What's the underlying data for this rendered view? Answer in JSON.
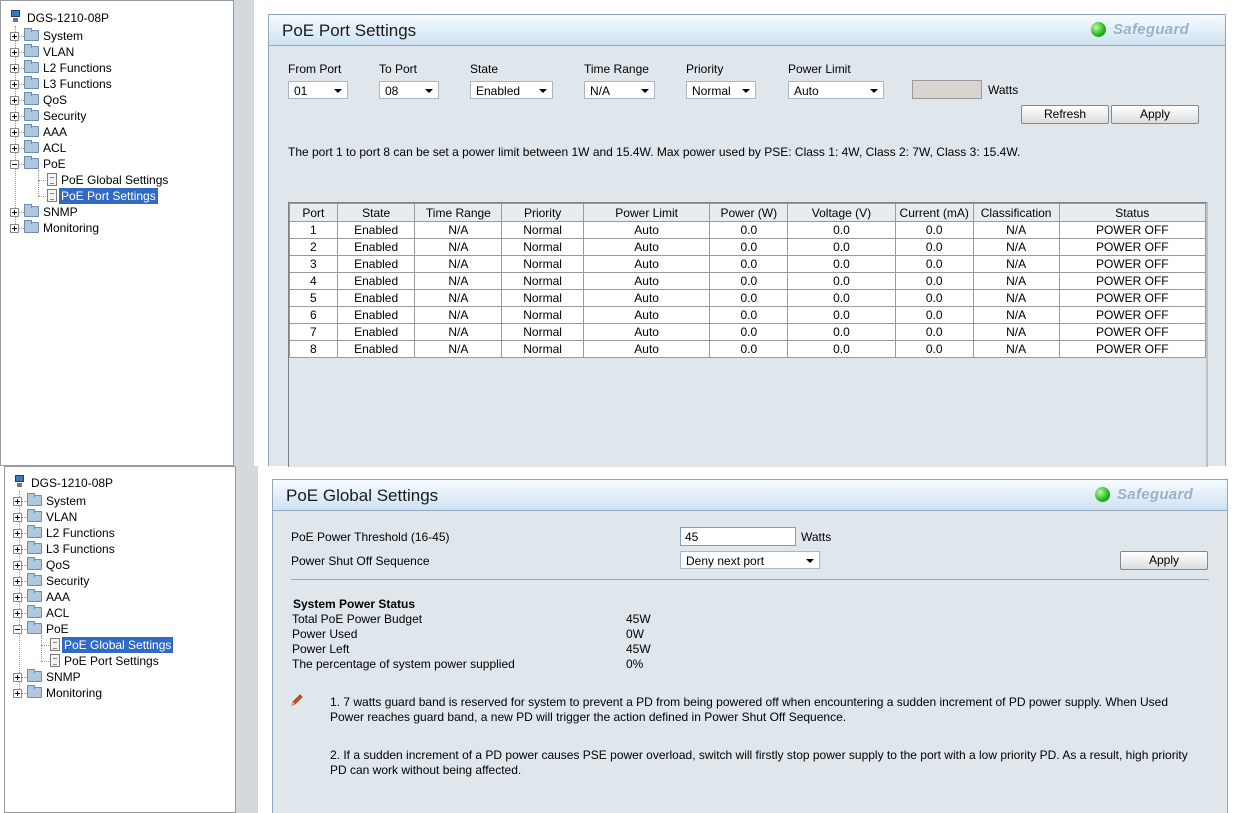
{
  "tree": {
    "root": "DGS-1210-08P",
    "items": [
      "System",
      "VLAN",
      "L2 Functions",
      "L3 Functions",
      "QoS",
      "Security",
      "AAA",
      "ACL",
      "PoE",
      "SNMP",
      "Monitoring"
    ],
    "poe_children": [
      "PoE Global Settings",
      "PoE Port Settings"
    ]
  },
  "safeguard_label": "Safeguard",
  "port_settings": {
    "title": "PoE Port Settings",
    "form": {
      "from_port_label": "From Port",
      "from_port_value": "01",
      "to_port_label": "To Port",
      "to_port_value": "08",
      "state_label": "State",
      "state_value": "Enabled",
      "time_range_label": "Time Range",
      "time_range_value": "N/A",
      "priority_label": "Priority",
      "priority_value": "Normal",
      "power_limit_label": "Power Limit",
      "power_limit_value": "Auto",
      "watts_unit": "Watts",
      "refresh_label": "Refresh",
      "apply_label": "Apply"
    },
    "note": "The port 1 to port 8 can be set a power limit between 1W and 15.4W. Max power used by PSE: Class 1: 4W, Class 2: 7W, Class 3: 15.4W.",
    "columns": [
      "Port",
      "State",
      "Time Range",
      "Priority",
      "Power Limit",
      "Power (W)",
      "Voltage (V)",
      "Current (mA)",
      "Classification",
      "Status"
    ],
    "rows": [
      [
        "1",
        "Enabled",
        "N/A",
        "Normal",
        "Auto",
        "0.0",
        "0.0",
        "0.0",
        "N/A",
        "POWER OFF"
      ],
      [
        "2",
        "Enabled",
        "N/A",
        "Normal",
        "Auto",
        "0.0",
        "0.0",
        "0.0",
        "N/A",
        "POWER OFF"
      ],
      [
        "3",
        "Enabled",
        "N/A",
        "Normal",
        "Auto",
        "0.0",
        "0.0",
        "0.0",
        "N/A",
        "POWER OFF"
      ],
      [
        "4",
        "Enabled",
        "N/A",
        "Normal",
        "Auto",
        "0.0",
        "0.0",
        "0.0",
        "N/A",
        "POWER OFF"
      ],
      [
        "5",
        "Enabled",
        "N/A",
        "Normal",
        "Auto",
        "0.0",
        "0.0",
        "0.0",
        "N/A",
        "POWER OFF"
      ],
      [
        "6",
        "Enabled",
        "N/A",
        "Normal",
        "Auto",
        "0.0",
        "0.0",
        "0.0",
        "N/A",
        "POWER OFF"
      ],
      [
        "7",
        "Enabled",
        "N/A",
        "Normal",
        "Auto",
        "0.0",
        "0.0",
        "0.0",
        "N/A",
        "POWER OFF"
      ],
      [
        "8",
        "Enabled",
        "N/A",
        "Normal",
        "Auto",
        "0.0",
        "0.0",
        "0.0",
        "N/A",
        "POWER OFF"
      ]
    ]
  },
  "global_settings": {
    "title": "PoE Global Settings",
    "threshold_label": "PoE Power Threshold (16-45)",
    "threshold_value": "45",
    "watts_unit": "Watts",
    "shutoff_label": "Power Shut Off Sequence",
    "shutoff_value": "Deny next port",
    "apply_label": "Apply",
    "status_heading": "System Power Status",
    "status": [
      {
        "label": "Total PoE Power Budget",
        "value": "45W"
      },
      {
        "label": "Power Used",
        "value": "0W"
      },
      {
        "label": "Power Left",
        "value": "45W"
      },
      {
        "label": "The percentage of system power supplied",
        "value": "0%"
      }
    ],
    "note1_line1": "1. 7 watts guard band is reserved for system to prevent a PD from being powered off when encountering a sudden increment of PD power supply. When Used",
    "note1_line2": "Power reaches guard band, a new PD will trigger the action defined in Power Shut Off Sequence.",
    "note2_line1": "2. If a sudden increment of a PD power causes PSE power overload, switch will firstly stop power supply to the port with a low priority PD. As a result, high priority",
    "note2_line2": "PD can work without being affected."
  },
  "colors": {
    "selection": "#316ac5",
    "panel": "#dfe6ec",
    "header_border": "#8fa7bf"
  }
}
